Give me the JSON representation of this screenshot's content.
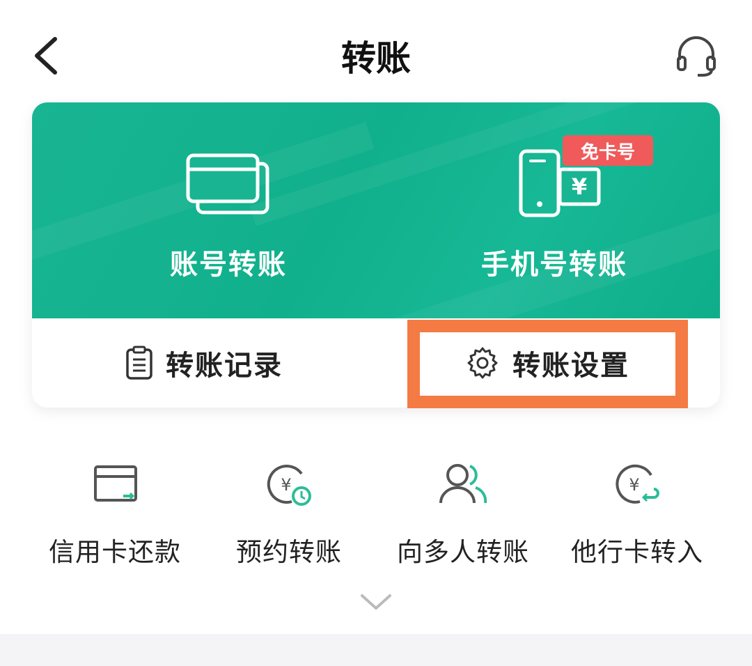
{
  "header": {
    "title": "转账",
    "back_icon": "chevron-left-icon",
    "service_icon": "headset-icon"
  },
  "card": {
    "accent_color": "#14b390",
    "actions": [
      {
        "label": "账号转账",
        "icon": "bank-card-icon"
      },
      {
        "label": "手机号转账",
        "icon": "phone-yuan-icon",
        "badge": "免卡号"
      }
    ],
    "bottom": [
      {
        "label": "转账记录",
        "icon": "clipboard-list-icon"
      },
      {
        "label": "转账设置",
        "icon": "gear-icon"
      }
    ],
    "highlight_color": "#f47b43"
  },
  "shortcuts": [
    {
      "label": "信用卡还款",
      "icon": "credit-card-icon"
    },
    {
      "label": "预约转账",
      "icon": "scheduled-yuan-icon"
    },
    {
      "label": "向多人转账",
      "icon": "users-icon"
    },
    {
      "label": "他行卡转入",
      "icon": "yuan-transfer-in-icon"
    }
  ],
  "expand_icon": "chevron-down-icon"
}
